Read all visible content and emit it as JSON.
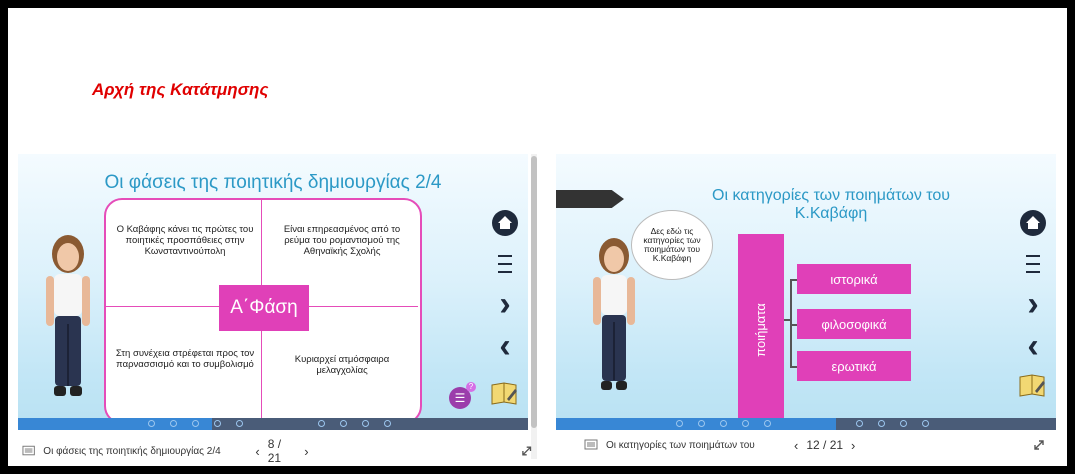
{
  "page": {
    "heading": "Αρχή της Κατάτμησης"
  },
  "left": {
    "title": "Οι φάσεις της ποιητικής δημιουργίας 2/4",
    "quadrants": {
      "top_left": "Ο Καβάφης κάνει τις πρώτες του ποιητικές προσπάθειες στην Κωνσταντινούπολη",
      "top_right": "Είναι επηρεασμένος από το ρεύμα του ρομαντισμού της Αθηναϊκής Σχολής",
      "bottom_left": "Στη συνέχεια στρέφεται προς τον παρνασσισμό και το συμβολισμό",
      "bottom_right": "Κυριαρχεί ατμόσφαιρα μελαγχολίας"
    },
    "center_label": "Α΄Φάση",
    "status_label": "Οι φάσεις της ποιητικής δημιουργίας 2/4",
    "page_indicator": "8 / 21",
    "progress": 0.38,
    "badge_glyph": "☰",
    "help_glyph": "?"
  },
  "right": {
    "title": "Οι κατηγορίες των ποιημάτων του Κ.Καβάφη",
    "callout": "Δες εδώ τις κατηγορίες των ποιημάτων του Κ.Καβάφη",
    "vertical_label": "ποιήματα",
    "categories": [
      "ιστορικά",
      "φιλοσοφικά",
      "ερωτικά"
    ],
    "status_label": "Οι κατηγορίες των ποιημάτων του",
    "page_indicator": "12 / 21",
    "progress": 0.56
  },
  "nav": {
    "prev_glyph": "‹",
    "next_glyph": "›"
  },
  "icons": [
    "home-icon",
    "menu-icon",
    "next-icon",
    "prev-icon",
    "book-icon",
    "expand-icon",
    "slide-icon",
    "avatar"
  ],
  "colors": {
    "accent_magenta": "#e040b8",
    "title_blue": "#2c99c6",
    "heading_red": "#e00000",
    "progress_blue": "#3887d5"
  }
}
